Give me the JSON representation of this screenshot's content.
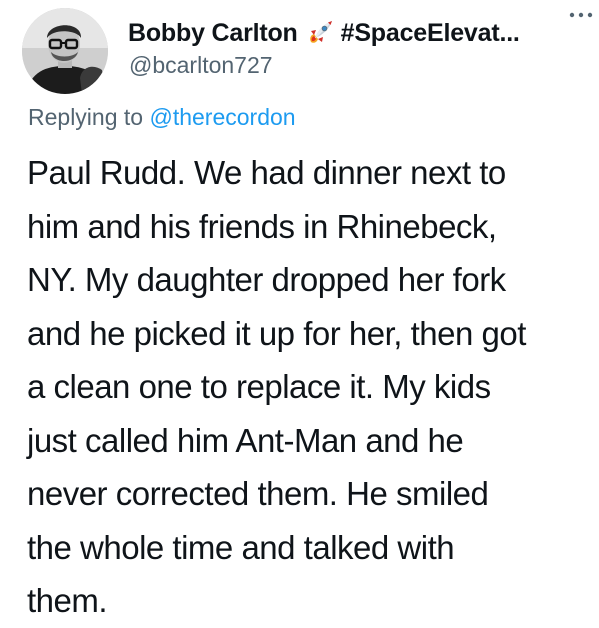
{
  "author": {
    "display_name": "Bobby Carlton",
    "display_suffix": "#SpaceElevat...",
    "handle": "@bcarlton727",
    "emoji_icon": "rocket-icon",
    "avatar_icon": "profile-photo"
  },
  "reply": {
    "prefix": "Replying to",
    "target": "@therecordon"
  },
  "more_icon": "ellipsis-icon",
  "body_lines": [
    "Paul Rudd. We had dinner next to",
    "him and his friends in Rhinebeck,",
    "NY. My daughter dropped her fork",
    "and he picked it up for her, then got",
    "a clean one to replace it. My kids",
    "just called him Ant-Man and he",
    "never corrected them. He smiled",
    "the whole time and talked with",
    "them."
  ],
  "colors": {
    "text": "#0f1419",
    "secondary": "#536471",
    "link": "#1d9bf0"
  }
}
